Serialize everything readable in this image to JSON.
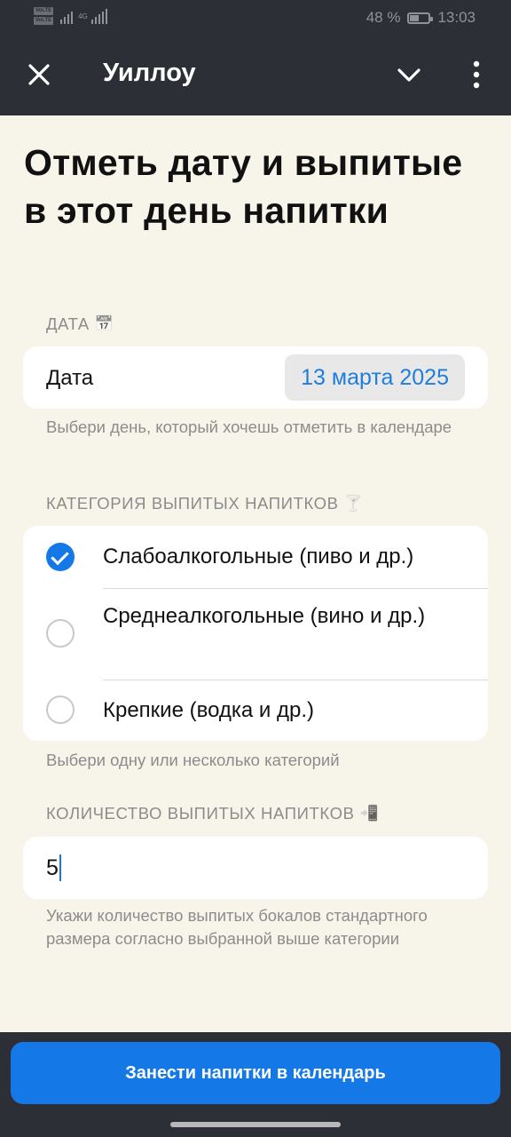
{
  "status_bar": {
    "volte_1": "VoLTE",
    "volte_2": "VoLTE",
    "network": "4G",
    "battery_percent": "48 %",
    "battery_level": 0.48,
    "time": "13:03"
  },
  "app_bar": {
    "title": "Уиллоу",
    "close_icon": "close-icon",
    "chevron_icon": "chevron-down-icon",
    "more_icon": "more-vertical-icon"
  },
  "page": {
    "heading": "Отметь дату и выпитые в этот день напитки"
  },
  "date_section": {
    "label": "ДАТА",
    "label_emoji": "📅",
    "field_label": "Дата",
    "value": "13 марта 2025",
    "hint": "Выбери день, который хочешь отметить в календаре"
  },
  "category_section": {
    "label": "КАТЕГОРИЯ ВЫПИТЫХ НАПИТКОВ",
    "label_emoji": "🍸",
    "options": [
      {
        "label": "Слабоалкогольные (пиво и др.)",
        "selected": true
      },
      {
        "label": "Среднеалкогольные (вино и др.)",
        "selected": false
      },
      {
        "label": "Крепкие (водка и др.)",
        "selected": false
      }
    ],
    "hint": "Выбери одну или несколько категорий"
  },
  "quantity_section": {
    "label": "КОЛИЧЕСТВО ВЫПИТЫХ НАПИТКОВ",
    "label_emoji": "📲",
    "value": "5",
    "hint": "Укажи количество выпитых бокалов стандартного размера согласно выбранной выше категории"
  },
  "submit_button": {
    "label": "Занести напитки в календарь"
  },
  "colors": {
    "accent": "#1479e6",
    "bar_background": "#2c2f35",
    "page_background": "#f7f4ea"
  }
}
